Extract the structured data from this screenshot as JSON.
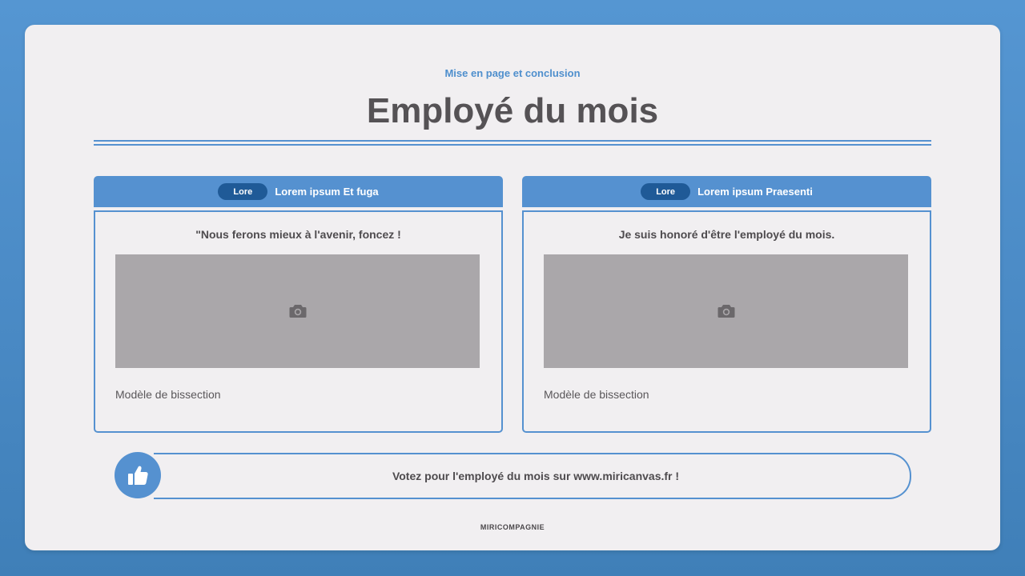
{
  "header": {
    "subtitle": "Mise en page et conclusion",
    "title": "Employé du mois"
  },
  "cards": [
    {
      "pill": "Lore",
      "title": "Lorem ipsum Et fuga",
      "quote": "\"Nous ferons mieux à l'avenir, foncez !",
      "image_icon": "camera-icon",
      "caption": "Modèle de bissection"
    },
    {
      "pill": "Lore",
      "title": "Lorem ipsum Praesenti",
      "quote": "Je suis honoré d'être l'employé du mois.",
      "image_icon": "camera-icon",
      "caption": "Modèle de bissection"
    }
  ],
  "vote": {
    "icon": "thumbs-up-icon",
    "text": "Votez pour l'employé du mois sur www.miricanvas.fr !"
  },
  "footer": {
    "brand": "MIRICOMPAGNIE"
  },
  "colors": {
    "background": "#4f8fcd",
    "accent": "#5591d0",
    "pill": "#1f5a97",
    "slide": "#f1eff1",
    "placeholder": "#aaa7aa",
    "text": "#555255"
  }
}
